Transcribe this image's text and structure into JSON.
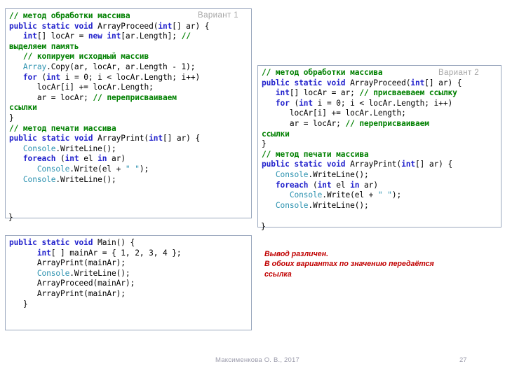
{
  "slide": {
    "background_color": "#ffffff",
    "panel_border_color": "#9aa7bd"
  },
  "colors": {
    "comment": "#008000",
    "keyword": "#2222cc",
    "type": "#2B91AF",
    "plain": "#000000",
    "note": "#c00000",
    "badge": "#a6a6a6",
    "footer": "#9b9bab"
  },
  "panels": {
    "variant_1": {
      "badge": "Вариант 1",
      "trailing_brace": "}",
      "lines": [
        [
          {
            "t": "// метод обработки массива",
            "c": "com"
          }
        ],
        [
          {
            "t": "public static void ",
            "c": "key"
          },
          {
            "t": "ArrayProceed(",
            "c": "pln"
          },
          {
            "t": "int",
            "c": "key"
          },
          {
            "t": "[] ar) {",
            "c": "pln"
          }
        ],
        [
          {
            "t": "   ",
            "c": "pln"
          },
          {
            "t": "int",
            "c": "key"
          },
          {
            "t": "[] locAr = ",
            "c": "pln"
          },
          {
            "t": "new int",
            "c": "key"
          },
          {
            "t": "[ar.Length]; ",
            "c": "pln"
          },
          {
            "t": "//",
            "c": "com"
          }
        ],
        [
          {
            "t": "выделяем память",
            "c": "com"
          }
        ],
        [
          {
            "t": "   ",
            "c": "pln"
          },
          {
            "t": "// копируем исходный массив",
            "c": "com"
          }
        ],
        [
          {
            "t": "   ",
            "c": "pln"
          },
          {
            "t": "Array",
            "c": "type"
          },
          {
            "t": ".Copy(ar, locAr, ar.Length - 1);",
            "c": "pln"
          }
        ],
        [
          {
            "t": "   ",
            "c": "pln"
          },
          {
            "t": "for ",
            "c": "key"
          },
          {
            "t": "(",
            "c": "pln"
          },
          {
            "t": "int",
            "c": "key"
          },
          {
            "t": " i = 0; i < locAr.Length; i++)",
            "c": "pln"
          }
        ],
        [
          {
            "t": "      locAr[i] += locAr.Length;",
            "c": "pln"
          }
        ],
        [
          {
            "t": "      ar = locAr; ",
            "c": "pln"
          },
          {
            "t": "// переприсваиваем",
            "c": "com"
          }
        ],
        [
          {
            "t": "ссылки",
            "c": "com"
          }
        ],
        [
          {
            "t": "}",
            "c": "pln"
          }
        ],
        [
          {
            "t": "// метод печати массива",
            "c": "com"
          }
        ],
        [
          {
            "t": "public static void ",
            "c": "key"
          },
          {
            "t": "ArrayPrint(",
            "c": "pln"
          },
          {
            "t": "int",
            "c": "key"
          },
          {
            "t": "[] ar) {",
            "c": "pln"
          }
        ],
        [
          {
            "t": "   ",
            "c": "pln"
          },
          {
            "t": "Console",
            "c": "type"
          },
          {
            "t": ".WriteLine();",
            "c": "pln"
          }
        ],
        [
          {
            "t": "   ",
            "c": "pln"
          },
          {
            "t": "foreach ",
            "c": "key"
          },
          {
            "t": "(",
            "c": "pln"
          },
          {
            "t": "int",
            "c": "key"
          },
          {
            "t": " el ",
            "c": "pln"
          },
          {
            "t": "in",
            "c": "key"
          },
          {
            "t": " ar)",
            "c": "pln"
          }
        ],
        [
          {
            "t": "      ",
            "c": "pln"
          },
          {
            "t": "Console",
            "c": "type"
          },
          {
            "t": ".Write(el + ",
            "c": "pln"
          },
          {
            "t": "\" \"",
            "c": "str"
          },
          {
            "t": ");",
            "c": "pln"
          }
        ],
        [
          {
            "t": "   ",
            "c": "pln"
          },
          {
            "t": "Console",
            "c": "type"
          },
          {
            "t": ".WriteLine();",
            "c": "pln"
          }
        ]
      ]
    },
    "variant_2": {
      "badge": "Вариант 2",
      "trailing_brace": "}",
      "lines": [
        [
          {
            "t": "// метод обработки массива",
            "c": "com"
          }
        ],
        [
          {
            "t": "public static void ",
            "c": "key"
          },
          {
            "t": "ArrayProceed(",
            "c": "pln"
          },
          {
            "t": "int",
            "c": "key"
          },
          {
            "t": "[] ar) {",
            "c": "pln"
          }
        ],
        [
          {
            "t": "   ",
            "c": "pln"
          },
          {
            "t": "int",
            "c": "key"
          },
          {
            "t": "[] locAr = ar; ",
            "c": "pln"
          },
          {
            "t": "// присваеваем ссылку",
            "c": "com"
          }
        ],
        [
          {
            "t": "   ",
            "c": "pln"
          },
          {
            "t": "for ",
            "c": "key"
          },
          {
            "t": "(",
            "c": "pln"
          },
          {
            "t": "int",
            "c": "key"
          },
          {
            "t": " i = 0; i < locAr.Length; i++)",
            "c": "pln"
          }
        ],
        [
          {
            "t": "      locAr[i] += locAr.Length;",
            "c": "pln"
          }
        ],
        [
          {
            "t": "      ar = locAr; ",
            "c": "pln"
          },
          {
            "t": "// переприсваиваем",
            "c": "com"
          }
        ],
        [
          {
            "t": "ссылки",
            "c": "com"
          }
        ],
        [
          {
            "t": "}",
            "c": "pln"
          }
        ],
        [
          {
            "t": "// метод печати массива",
            "c": "com"
          }
        ],
        [
          {
            "t": "public static void ",
            "c": "key"
          },
          {
            "t": "ArrayPrint(",
            "c": "pln"
          },
          {
            "t": "int",
            "c": "key"
          },
          {
            "t": "[] ar) {",
            "c": "pln"
          }
        ],
        [
          {
            "t": "   ",
            "c": "pln"
          },
          {
            "t": "Console",
            "c": "type"
          },
          {
            "t": ".WriteLine();",
            "c": "pln"
          }
        ],
        [
          {
            "t": "   ",
            "c": "pln"
          },
          {
            "t": "foreach ",
            "c": "key"
          },
          {
            "t": "(",
            "c": "pln"
          },
          {
            "t": "int",
            "c": "key"
          },
          {
            "t": " el ",
            "c": "pln"
          },
          {
            "t": "in",
            "c": "key"
          },
          {
            "t": " ar)",
            "c": "pln"
          }
        ],
        [
          {
            "t": "      ",
            "c": "pln"
          },
          {
            "t": "Console",
            "c": "type"
          },
          {
            "t": ".Write(el + ",
            "c": "pln"
          },
          {
            "t": "\" \"",
            "c": "str"
          },
          {
            "t": ");",
            "c": "pln"
          }
        ],
        [
          {
            "t": "   ",
            "c": "pln"
          },
          {
            "t": "Console",
            "c": "type"
          },
          {
            "t": ".WriteLine();",
            "c": "pln"
          }
        ]
      ]
    },
    "main_method": {
      "lines": [
        [
          {
            "t": "public static void ",
            "c": "key"
          },
          {
            "t": "Main() {",
            "c": "pln"
          }
        ],
        [
          {
            "t": "      ",
            "c": "pln"
          },
          {
            "t": "int",
            "c": "key"
          },
          {
            "t": "[ ] mainAr = { 1, 2, 3, 4 };",
            "c": "pln"
          }
        ],
        [
          {
            "t": "      ArrayPrint(mainAr);",
            "c": "pln"
          }
        ],
        [
          {
            "t": "      ",
            "c": "pln"
          },
          {
            "t": "Console",
            "c": "type"
          },
          {
            "t": ".WriteLine();",
            "c": "pln"
          }
        ],
        [
          {
            "t": "      ArrayProceed(mainAr);",
            "c": "pln"
          }
        ],
        [
          {
            "t": "      ArrayPrint(mainAr);",
            "c": "pln"
          }
        ],
        [
          {
            "t": "   }",
            "c": "pln"
          }
        ]
      ]
    }
  },
  "conclusion_note": {
    "lines": [
      "Вывод различен.",
      "В обоих вариантах по значению передаётся",
      "ссылка"
    ]
  },
  "footer": {
    "author": "Максименкова О. В., 2017",
    "page_number": "27"
  }
}
